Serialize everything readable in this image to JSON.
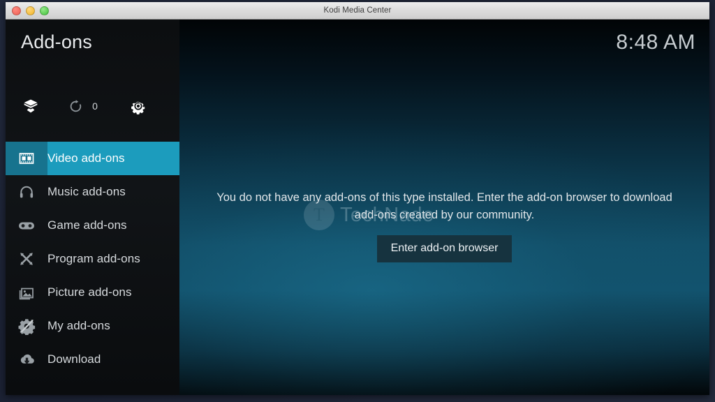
{
  "window": {
    "title": "Kodi Media Center",
    "controls": [
      "close",
      "minimize",
      "zoom"
    ]
  },
  "sidebar": {
    "page_title": "Add-ons",
    "toolbar": [
      {
        "name": "package-icon",
        "label": ""
      },
      {
        "name": "update-icon",
        "label": "0"
      },
      {
        "name": "gear-icon",
        "label": ""
      }
    ],
    "update_count": "0",
    "items": [
      {
        "label": "Video add-ons",
        "icon": "film-icon",
        "selected": true
      },
      {
        "label": "Music add-ons",
        "icon": "headphones-icon",
        "selected": false
      },
      {
        "label": "Game add-ons",
        "icon": "gamepad-icon",
        "selected": false
      },
      {
        "label": "Program add-ons",
        "icon": "tools-icon",
        "selected": false
      },
      {
        "label": "Picture add-ons",
        "icon": "image-icon",
        "selected": false
      },
      {
        "label": "My add-ons",
        "icon": "puzzle-gear-icon",
        "selected": false
      },
      {
        "label": "Download",
        "icon": "cloud-download-icon",
        "selected": false
      }
    ]
  },
  "main": {
    "clock": "8:48 AM",
    "empty_message": "You do not have any add-ons of this type installed. Enter the add-on browser to download add-ons created by our community.",
    "button_label": "Enter add-on browser"
  },
  "watermark": {
    "logo_letter": "T",
    "text": "TechNado"
  },
  "colors": {
    "accent": "#1c9cbd",
    "accent_dark": "#17738e",
    "sidebar_bg": "#111417",
    "button_bg": "#16333f",
    "text": "#e2e7ea"
  }
}
